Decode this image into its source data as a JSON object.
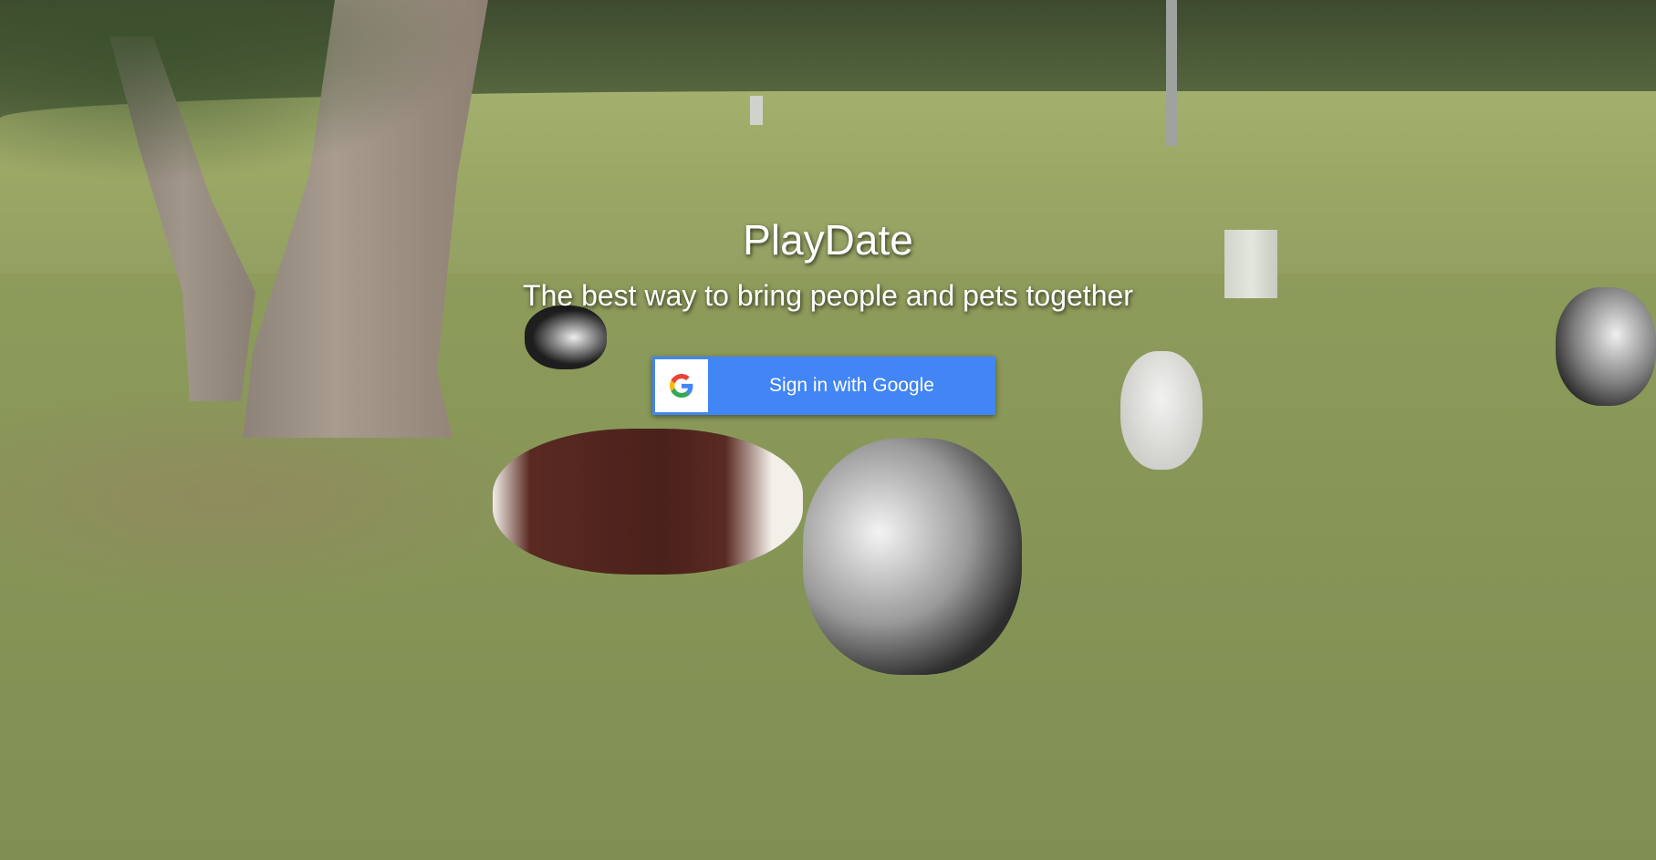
{
  "app": {
    "title": "PlayDate",
    "tagline": "The best way to bring people and pets together"
  },
  "auth": {
    "google_button_label": "Sign in with Google",
    "google_icon": "google-g-icon"
  },
  "colors": {
    "google_blue": "#4285f4",
    "text": "#ffffff"
  }
}
